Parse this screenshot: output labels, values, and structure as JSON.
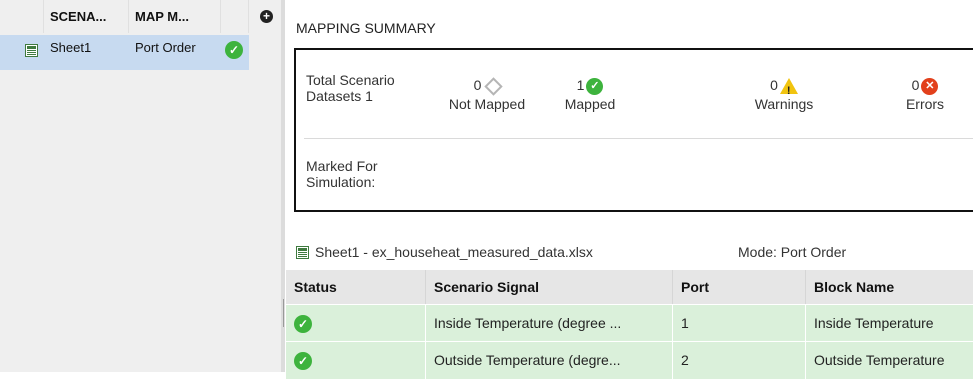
{
  "scenarios": {
    "columns": [
      "SCENA...",
      "MAP M..."
    ],
    "rows": [
      {
        "name": "Sheet1",
        "mapping_mode": "Port Order",
        "status_icon": "check-icon"
      }
    ],
    "add_icon": "plus-icon"
  },
  "summary": {
    "title": "MAPPING SUMMARY",
    "total_label": "Total Scenario Datasets 1",
    "stats": [
      {
        "count": "0",
        "label": "Not Mapped",
        "icon": "diamond-icon"
      },
      {
        "count": "1",
        "label": "Mapped",
        "icon": "check-icon"
      },
      {
        "count": "0",
        "label": "Warnings",
        "icon": "warning-icon"
      },
      {
        "count": "0",
        "label": "Errors",
        "icon": "error-icon"
      }
    ],
    "marked_label": "Marked For Simulation:"
  },
  "file": {
    "label": "Sheet1 - ex_househeat_measured_data.xlsx",
    "mode": "Mode: Port Order"
  },
  "table": {
    "headers": [
      "Status",
      "Scenario Signal",
      "Port",
      "Block Name"
    ],
    "rows": [
      {
        "status": "check-icon",
        "signal": "Inside Temperature (degree ...",
        "port": "1",
        "block": "Inside Temperature"
      },
      {
        "status": "check-icon",
        "signal": "Outside Temperature (degre...",
        "port": "2",
        "block": "Outside Temperature"
      }
    ]
  },
  "colors": {
    "selected_row": "#c7daf0",
    "mapped_row": "#daf0da",
    "success": "#3db33d",
    "warning": "#f1c40f",
    "error": "#e2401c"
  }
}
